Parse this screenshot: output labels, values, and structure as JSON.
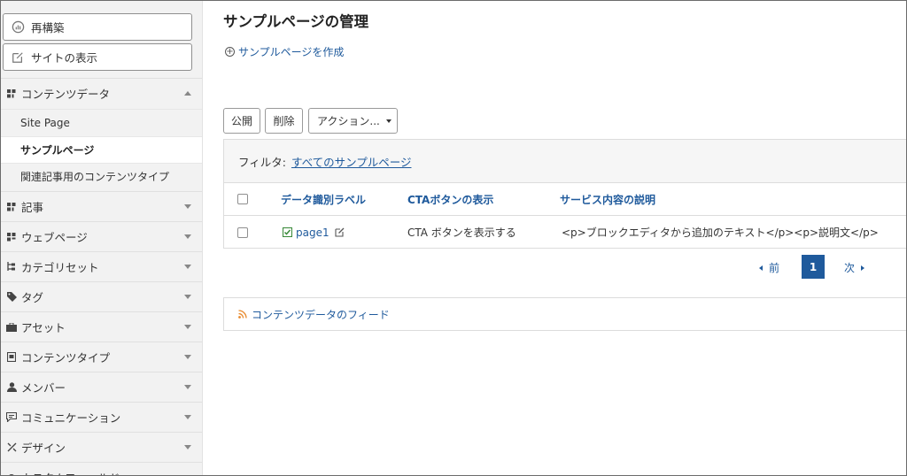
{
  "sidebar": {
    "rebuild_label": "再構築",
    "view_site_label": "サイトの表示",
    "content_data": {
      "label": "コンテンツデータ",
      "items": [
        "Site Page",
        "サンプルページ",
        "関連記事用のコンテンツタイプ"
      ]
    },
    "sections": [
      "記事",
      "ウェブページ",
      "カテゴリセット",
      "タグ",
      "アセット",
      "コンテンツタイプ",
      "メンバー",
      "コミュニケーション",
      "デザイン",
      "カスタムフィールド"
    ]
  },
  "main": {
    "title": "サンプルページの管理",
    "create_link": "サンプルページを作成",
    "actions": {
      "publish": "公開",
      "delete": "削除",
      "more": "アクション..."
    },
    "filter": {
      "label": "フィルタ:",
      "value": "すべてのサンプルページ"
    },
    "table": {
      "headers": [
        "データ識別ラベル",
        "CTAボタンの表示",
        "サービス内容の説明"
      ],
      "rows": [
        {
          "label": "page1",
          "cta": "CTA ボタンを表示する",
          "desc": "<p>ブロックエディタから追加のテキスト</p><p>説明文</p>"
        }
      ]
    },
    "pagination": {
      "prev": "前",
      "current": "1",
      "next": "次"
    },
    "feed_link": "コンテンツデータのフィード"
  },
  "colors": {
    "link": "#1f5a9c",
    "sidebar_bg": "#f2f2f2",
    "status_green": "#3a8a3a",
    "rss_orange": "#e8892b"
  }
}
